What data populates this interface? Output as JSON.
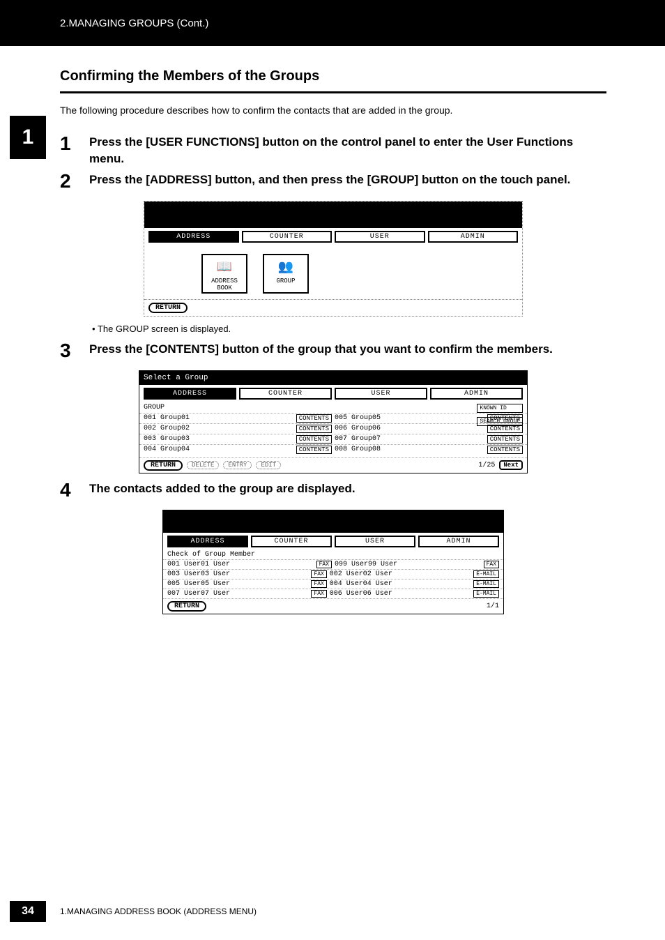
{
  "header": {
    "breadcrumb": "2.MANAGING GROUPS (Cont.)"
  },
  "sidetab": {
    "label": "1"
  },
  "section": {
    "title": "Confirming the Members of the Groups"
  },
  "intro": "The following procedure describes how to confirm the contacts that are added in the group.",
  "steps": {
    "s1": {
      "num": "1",
      "text": "Press the [USER FUNCTIONS] button on the control panel to enter the User Functions menu."
    },
    "s2": {
      "num": "2",
      "text": "Press the [ADDRESS] button, and then press the [GROUP] button on the touch panel."
    },
    "s2_note": "The GROUP screen is displayed.",
    "s3": {
      "num": "3",
      "text": "Press the [CONTENTS] button of the group that you want to confirm the members."
    },
    "s4": {
      "num": "4",
      "text": "The contacts added to the group are displayed."
    }
  },
  "screen1": {
    "tabs": [
      "ADDRESS",
      "COUNTER",
      "USER",
      "ADMIN"
    ],
    "icons": {
      "addressbook": "ADDRESS BOOK",
      "group": "GROUP"
    },
    "return_btn": "RETURN"
  },
  "screen2": {
    "title": "Select a Group",
    "tabs": [
      "ADDRESS",
      "COUNTER",
      "USER",
      "ADMIN"
    ],
    "subhead": "GROUP",
    "rows": [
      {
        "idL": "001",
        "nameL": "Group01",
        "idR": "005",
        "nameR": "Group05"
      },
      {
        "idL": "002",
        "nameL": "Group02",
        "idR": "006",
        "nameR": "Group06"
      },
      {
        "idL": "003",
        "nameL": "Group03",
        "idR": "007",
        "nameR": "Group07"
      },
      {
        "idL": "004",
        "nameL": "Group04",
        "idR": "008",
        "nameR": "Group08"
      }
    ],
    "contents_label": "CONTENTS",
    "right_btns": {
      "known": "KNOWN ID",
      "search": "SEARCH GROUP"
    },
    "footer": {
      "return": "RETURN",
      "delete": "DELETE",
      "entry": "ENTRY",
      "edit": "EDIT",
      "pager": "1/25",
      "next": "Next"
    }
  },
  "screen3": {
    "tabs": [
      "ADDRESS",
      "COUNTER",
      "USER",
      "ADMIN"
    ],
    "checklabel": "Check of Group Member",
    "rows": [
      {
        "idL": "001",
        "nameL": "User01 User",
        "typeL": "FAX",
        "idR": "099",
        "nameR": "User99 User",
        "typeR": "FAX"
      },
      {
        "idL": "003",
        "nameL": "User03 User",
        "typeL": "FAX",
        "idR": "002",
        "nameR": "User02 User",
        "typeR": "E-MAIL"
      },
      {
        "idL": "005",
        "nameL": "User05 User",
        "typeL": "FAX",
        "idR": "004",
        "nameR": "User04 User",
        "typeR": "E-MAIL"
      },
      {
        "idL": "007",
        "nameL": "User07 User",
        "typeL": "FAX",
        "idR": "006",
        "nameR": "User06 User",
        "typeR": "E-MAIL"
      }
    ],
    "footer": {
      "return": "RETURN",
      "pager": "1/1"
    }
  },
  "footer": {
    "pagenum": "34",
    "text": "1.MANAGING ADDRESS BOOK (ADDRESS MENU)"
  }
}
